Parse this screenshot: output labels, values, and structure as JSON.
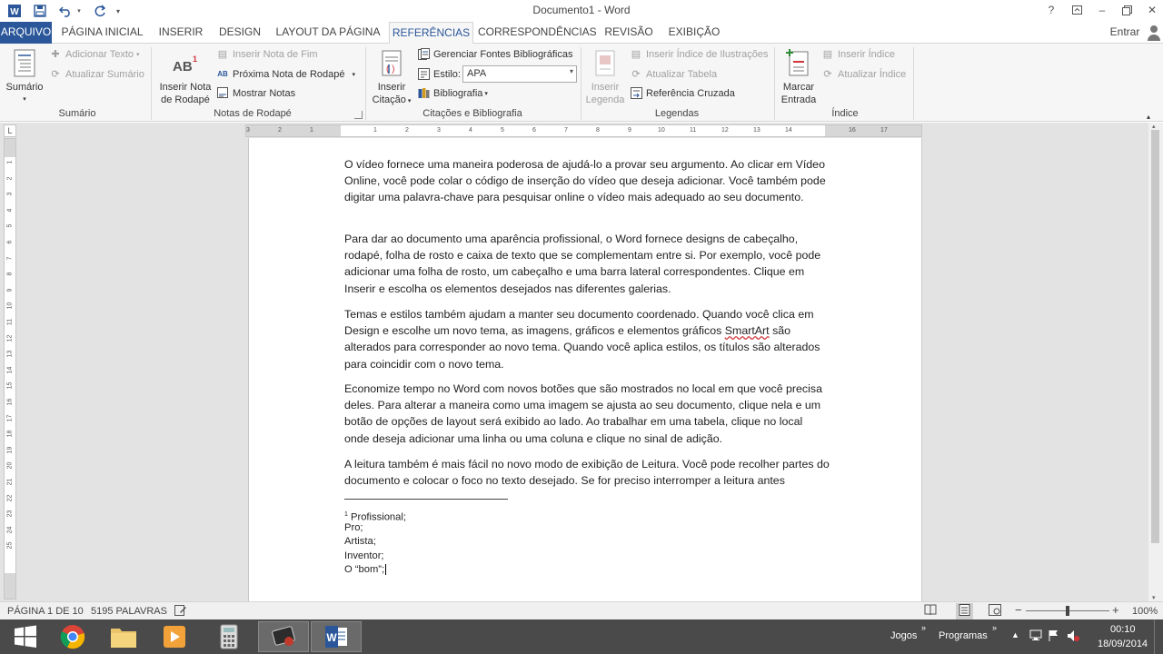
{
  "titlebar": {
    "title": "Documento1 - Word",
    "help": "?",
    "minimize": "–",
    "close": "✕"
  },
  "tabs": [
    {
      "label": "ARQUIVO"
    },
    {
      "label": "PÁGINA INICIAL"
    },
    {
      "label": "INSERIR"
    },
    {
      "label": "DESIGN"
    },
    {
      "label": "LAYOUT DA PÁGINA"
    },
    {
      "label": "REFERÊNCIAS"
    },
    {
      "label": "CORRESPONDÊNCIAS"
    },
    {
      "label": "REVISÃO"
    },
    {
      "label": "EXIBIÇÃO"
    }
  ],
  "account": "Entrar",
  "ribbon": {
    "sumario": {
      "big_label": "Sumário",
      "add_text": "Adicionar Texto",
      "update": "Atualizar Sumário",
      "group": "Sumário"
    },
    "notas": {
      "insert_footnote_1": "Inserir Nota",
      "insert_footnote_2": "de Rodapé",
      "insert_endnote": "Inserir Nota de Fim",
      "next_footnote": "Próxima Nota de Rodapé",
      "show_notes": "Mostrar Notas",
      "group": "Notas de Rodapé",
      "ab_icon": "AB",
      "ab_sup": "1"
    },
    "citacoes": {
      "insert_citation_1": "Inserir",
      "insert_citation_2": "Citação",
      "manage_sources": "Gerenciar Fontes Bibliográficas",
      "style_label": "Estilo:",
      "style_value": "APA",
      "bibliography": "Bibliografia",
      "group": "Citações e Bibliografia"
    },
    "legendas": {
      "insert_caption_1": "Inserir",
      "insert_caption_2": "Legenda",
      "insert_table_figures": "Inserir Índice de Ilustrações",
      "update_table": "Atualizar Tabela",
      "cross_reference": "Referência Cruzada",
      "group": "Legendas"
    },
    "indice": {
      "mark_entry_1": "Marcar",
      "mark_entry_2": "Entrada",
      "insert_index": "Inserir Índice",
      "update_index": "Atualizar Índice",
      "group": "Índice"
    }
  },
  "ruler": {
    "h_ticks": [
      "3",
      "2",
      "1",
      "1",
      "2",
      "3",
      "4",
      "5",
      "6",
      "7",
      "8",
      "9",
      "10",
      "11",
      "12",
      "13",
      "14",
      "16",
      "17"
    ],
    "v_ticks": [
      "1",
      "2",
      "3",
      "4",
      "5",
      "6",
      "7",
      "8",
      "9",
      "10",
      "11",
      "12",
      "13",
      "14",
      "15",
      "16",
      "17",
      "18",
      "19",
      "20",
      "21",
      "22",
      "23",
      "24",
      "25"
    ]
  },
  "document": {
    "paragraphs": [
      "O vídeo fornece uma maneira poderosa de ajudá-lo a provar seu argumento. Ao clicar em Vídeo Online, você pode colar o código de inserção do vídeo que deseja adicionar. Você também pode digitar uma palavra-chave para pesquisar online o vídeo mais adequado ao seu documento.",
      "Para dar ao documento uma aparência profissional, o Word fornece designs de cabeçalho, rodapé, folha de rosto e caixa de texto que se complementam entre si. Por exemplo, você pode adicionar uma folha de rosto, um cabeçalho e uma barra lateral correspondentes. Clique em Inserir e escolha os elementos desejados nas diferentes galerias.",
      "Economize tempo no Word com novos botões que são mostrados no local em que você precisa deles. Para alterar a maneira como uma imagem se ajusta ao seu documento, clique nela e um botão de opções de layout será exibido ao lado. Ao trabalhar em uma tabela, clique no local onde deseja adicionar uma linha ou uma coluna e clique no sinal de adição.",
      "A leitura também é mais fácil no novo modo de exibição de Leitura. Você pode recolher partes do documento e colocar o foco no texto desejado. Se for preciso interromper a leitura antes"
    ],
    "p3_before": "Temas e estilos também ajudam a manter seu documento coordenado. Quando você clica em Design e escolhe um novo tema, as imagens, gráficos e elementos gráficos ",
    "p3_misspelled": "SmartArt",
    "p3_after": " são alterados para corresponder ao novo tema. Quando você aplica estilos, os títulos são alterados para coincidir com o novo tema.",
    "footnote_number": "1",
    "footnotes": [
      "Profissional;",
      "Pro;",
      "Artista;",
      "Inventor;",
      "O “bom”;"
    ]
  },
  "statusbar": {
    "page": "PÁGINA 1 DE 10",
    "words": "5195 PALAVRAS",
    "zoom": "100%",
    "zoom_level": 1.0
  },
  "taskbar": {
    "games": "Jogos",
    "programs": "Programas",
    "time": "00:10",
    "date": "18/09/2014"
  },
  "colors": {
    "accent": "#2b579a",
    "taskbar": "#4a4a4a"
  }
}
